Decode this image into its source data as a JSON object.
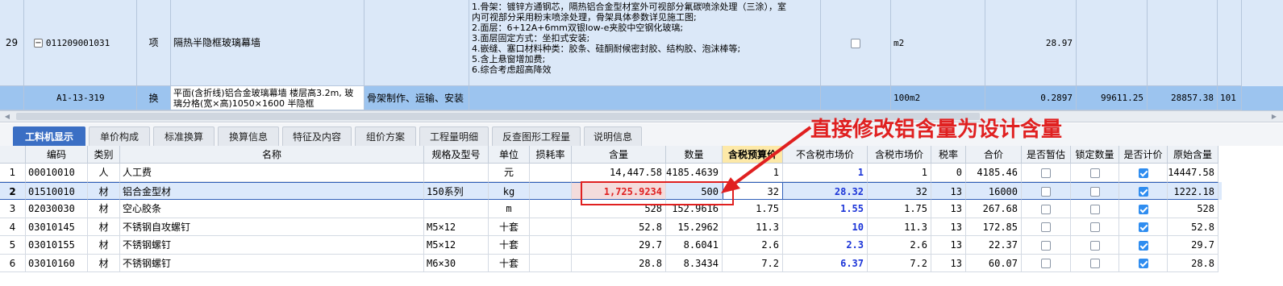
{
  "upper": {
    "row1": {
      "num": "29",
      "code": "011209001031",
      "type": "项",
      "name": "隔热半隐框玻璃幕墙",
      "desc_lines": [
        "1.骨架：镀锌方通钢芯，隔热铝合金型材室外可视部分氟碳喷涂处理（三涂），室",
        "内可视部分采用粉末喷涂处理，骨架具体参数详见施工图;",
        "2.面层：6+12A+6mm双银low-e夹胶中空钢化玻璃;",
        "3.面层固定方式：坐扣式安装;",
        "4.嵌缝、塞口材料种类：胶条、硅酮耐候密封胶、结构胶、泡沫棒等;",
        "5.含上悬窗增加费;",
        "6.综合考虑超高降效"
      ],
      "unit": "m2",
      "qty": "28.97"
    },
    "row2": {
      "code": "A1-13-319",
      "type": "换",
      "name": "平面(含折线)铝合金玻璃幕墙 楼层高3.2m, 玻璃分格(宽×高)1050×1600 半隐框",
      "work": "骨架制作、运输、安装",
      "unit": "100m2",
      "qty": "0.2897",
      "price": "99611.25",
      "total": "28857.38",
      "extra": "101"
    }
  },
  "tabs": [
    "工料机显示",
    "单价构成",
    "标准换算",
    "换算信息",
    "特征及内容",
    "组价方案",
    "工程量明细",
    "反查图形工程量",
    "说明信息"
  ],
  "columns": [
    "编码",
    "类别",
    "名称",
    "规格及型号",
    "单位",
    "损耗率",
    "含量",
    "数量",
    "含税预算价",
    "不含税市场价",
    "含税市场价",
    "税率",
    "合价",
    "是否暂估",
    "锁定数量",
    "是否计价",
    "原始含量"
  ],
  "rows": [
    {
      "no": "1",
      "code": "00010010",
      "cat": "人",
      "name": "人工费",
      "spec": "",
      "unit": "元",
      "loss": "",
      "content": "14,447.58",
      "qty": "4185.4639",
      "budget": "1",
      "mkt_ex": "1",
      "mkt_in": "1",
      "tax": "0",
      "total": "4185.46",
      "est": false,
      "lock": false,
      "priced": true,
      "orig": "14447.58"
    },
    {
      "no": "2",
      "code": "01510010",
      "cat": "材",
      "name": "铝合金型材",
      "spec": "150系列",
      "unit": "kg",
      "loss": "",
      "content": "1,725.9234",
      "qty": "500",
      "budget": "32",
      "mkt_ex": "28.32",
      "mkt_in": "32",
      "tax": "13",
      "total": "16000",
      "est": false,
      "lock": false,
      "priced": true,
      "orig": "1222.18"
    },
    {
      "no": "3",
      "code": "02030030",
      "cat": "材",
      "name": "空心胶条",
      "spec": "",
      "unit": "m",
      "loss": "",
      "content": "528",
      "qty": "152.9616",
      "budget": "1.75",
      "mkt_ex": "1.55",
      "mkt_in": "1.75",
      "tax": "13",
      "total": "267.68",
      "est": false,
      "lock": false,
      "priced": true,
      "orig": "528"
    },
    {
      "no": "4",
      "code": "03010145",
      "cat": "材",
      "name": "不锈钢自攻螺钉",
      "spec": "M5×12",
      "unit": "十套",
      "loss": "",
      "content": "52.8",
      "qty": "15.2962",
      "budget": "11.3",
      "mkt_ex": "10",
      "mkt_in": "11.3",
      "tax": "13",
      "total": "172.85",
      "est": false,
      "lock": false,
      "priced": true,
      "orig": "52.8"
    },
    {
      "no": "5",
      "code": "03010155",
      "cat": "材",
      "name": "不锈钢螺钉",
      "spec": "M5×12",
      "unit": "十套",
      "loss": "",
      "content": "29.7",
      "qty": "8.6041",
      "budget": "2.6",
      "mkt_ex": "2.3",
      "mkt_in": "2.6",
      "tax": "13",
      "total": "22.37",
      "est": false,
      "lock": false,
      "priced": true,
      "orig": "29.7"
    },
    {
      "no": "6",
      "code": "03010160",
      "cat": "材",
      "name": "不锈钢螺钉",
      "spec": "M6×30",
      "unit": "十套",
      "loss": "",
      "content": "28.8",
      "qty": "8.3434",
      "budget": "7.2",
      "mkt_ex": "6.37",
      "mkt_in": "7.2",
      "tax": "13",
      "total": "60.07",
      "est": false,
      "lock": false,
      "priced": true,
      "orig": "28.8"
    }
  ],
  "annotation": "直接修改铝含量为设计含量",
  "colors": {
    "accent": "#3b6fc4",
    "annotation": "#e02020",
    "blue_value": "#1c35d8",
    "selected_row": "#dce9fb",
    "upper_selected": "#9cc4ef"
  }
}
